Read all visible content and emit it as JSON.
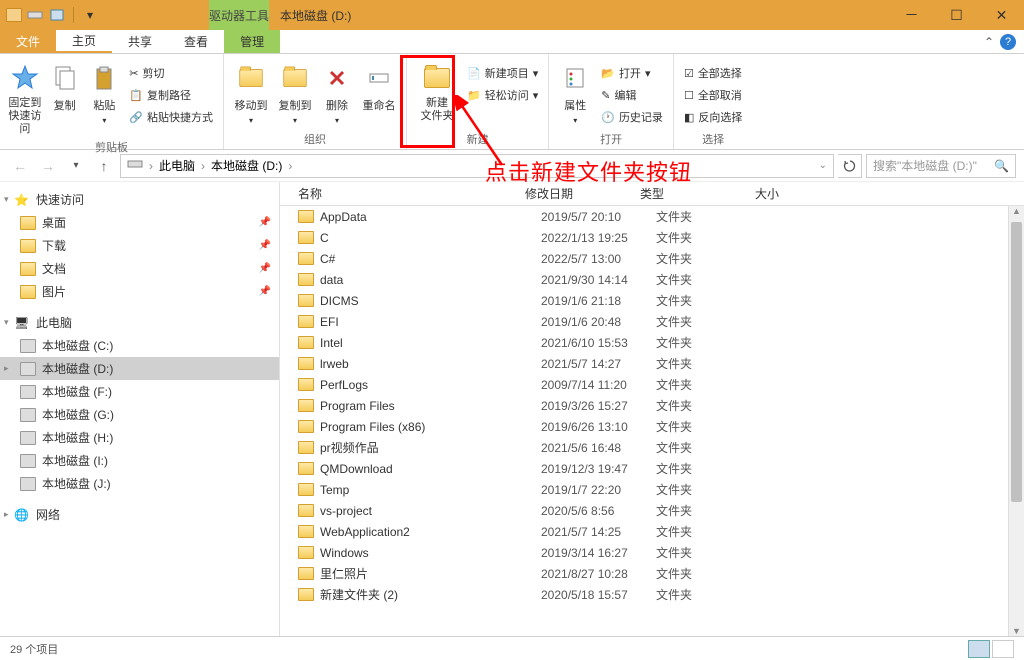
{
  "titlebar": {
    "context_tab": "驱动器工具",
    "title": "本地磁盘 (D:)"
  },
  "tabs": {
    "file": "文件",
    "home": "主页",
    "share": "共享",
    "view": "查看",
    "manage": "管理"
  },
  "ribbon": {
    "clipboard": {
      "pin": "固定到\n快速访问",
      "copy": "复制",
      "paste": "粘贴",
      "cut": "剪切",
      "copy_path": "复制路径",
      "paste_shortcut": "粘贴快捷方式",
      "group": "剪贴板"
    },
    "organize": {
      "move_to": "移动到",
      "copy_to": "复制到",
      "delete": "删除",
      "rename": "重命名",
      "group": "组织"
    },
    "new": {
      "new_folder": "新建\n文件夹",
      "new_item": "新建项目",
      "easy_access": "轻松访问",
      "group": "新建"
    },
    "open": {
      "properties": "属性",
      "open": "打开",
      "edit": "编辑",
      "history": "历史记录",
      "group": "打开"
    },
    "select": {
      "select_all": "全部选择",
      "select_none": "全部取消",
      "invert": "反向选择",
      "group": "选择"
    }
  },
  "annotation": "点击新建文件夹按钮",
  "breadcrumb": {
    "this_pc": "此电脑",
    "drive": "本地磁盘 (D:)"
  },
  "search_placeholder": "搜索\"本地磁盘 (D:)\"",
  "sidebar": {
    "quick_access": "快速访问",
    "quick_items": [
      "桌面",
      "下载",
      "文档",
      "图片"
    ],
    "this_pc": "此电脑",
    "drives": [
      "本地磁盘 (C:)",
      "本地磁盘 (D:)",
      "本地磁盘 (F:)",
      "本地磁盘 (G:)",
      "本地磁盘 (H:)",
      "本地磁盘 (I:)",
      "本地磁盘 (J:)"
    ],
    "network": "网络"
  },
  "columns": {
    "name": "名称",
    "date": "修改日期",
    "type": "类型",
    "size": "大小"
  },
  "files": [
    {
      "name": "AppData",
      "date": "2019/5/7 20:10",
      "type": "文件夹"
    },
    {
      "name": "C",
      "date": "2022/1/13 19:25",
      "type": "文件夹"
    },
    {
      "name": "C#",
      "date": "2022/5/7 13:00",
      "type": "文件夹"
    },
    {
      "name": "data",
      "date": "2021/9/30 14:14",
      "type": "文件夹"
    },
    {
      "name": "DICMS",
      "date": "2019/1/6 21:18",
      "type": "文件夹"
    },
    {
      "name": "EFI",
      "date": "2019/1/6 20:48",
      "type": "文件夹"
    },
    {
      "name": "Intel",
      "date": "2021/6/10 15:53",
      "type": "文件夹"
    },
    {
      "name": "lrweb",
      "date": "2021/5/7 14:27",
      "type": "文件夹"
    },
    {
      "name": "PerfLogs",
      "date": "2009/7/14 11:20",
      "type": "文件夹"
    },
    {
      "name": "Program Files",
      "date": "2019/3/26 15:27",
      "type": "文件夹"
    },
    {
      "name": "Program Files (x86)",
      "date": "2019/6/26 13:10",
      "type": "文件夹"
    },
    {
      "name": "pr视频作品",
      "date": "2021/5/6 16:48",
      "type": "文件夹"
    },
    {
      "name": "QMDownload",
      "date": "2019/12/3 19:47",
      "type": "文件夹"
    },
    {
      "name": "Temp",
      "date": "2019/1/7 22:20",
      "type": "文件夹"
    },
    {
      "name": "vs-project",
      "date": "2020/5/6 8:56",
      "type": "文件夹"
    },
    {
      "name": "WebApplication2",
      "date": "2021/5/7 14:25",
      "type": "文件夹"
    },
    {
      "name": "Windows",
      "date": "2019/3/14 16:27",
      "type": "文件夹"
    },
    {
      "name": "里仁照片",
      "date": "2021/8/27 10:28",
      "type": "文件夹"
    },
    {
      "name": "新建文件夹 (2)",
      "date": "2020/5/18 15:57",
      "type": "文件夹"
    }
  ],
  "status": "29 个项目"
}
